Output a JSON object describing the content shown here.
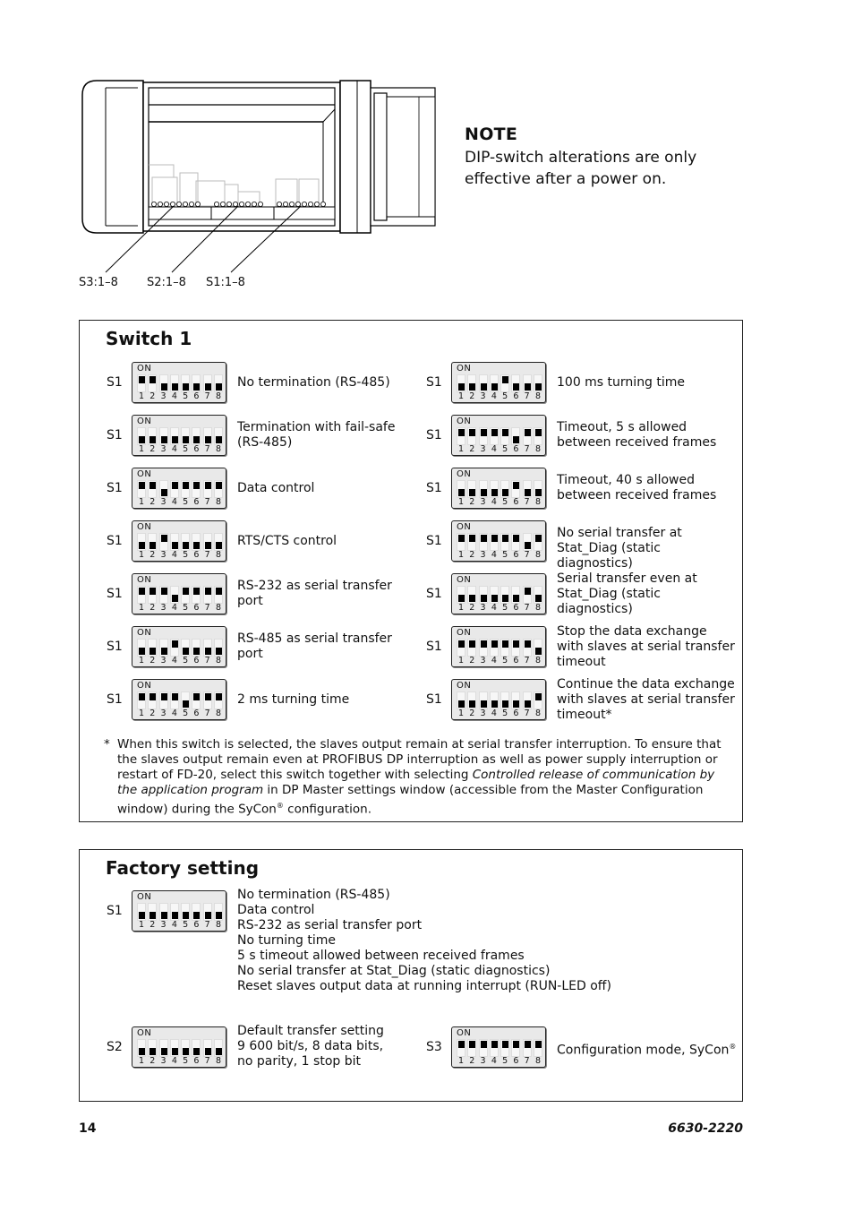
{
  "illustration": {
    "labels": [
      "S3:1–8",
      "S2:1–8",
      "S1:1–8"
    ]
  },
  "note": {
    "title": "NOTE",
    "text": "DIP-switch alterations are only effective after a power on."
  },
  "switch1": {
    "title": "Switch 1",
    "on_label": "ON",
    "left": [
      {
        "switch": "S1",
        "on": [
          1,
          2
        ],
        "desc": "No termination (RS-485)"
      },
      {
        "switch": "S1",
        "on": [],
        "desc": "Termination with fail-safe (RS-485)"
      },
      {
        "switch": "S1",
        "on": [
          1,
          2,
          4,
          5,
          6,
          7,
          8
        ],
        "desc": "Data control"
      },
      {
        "switch": "S1",
        "on": [
          3
        ],
        "desc": "RTS/CTS control"
      },
      {
        "switch": "S1",
        "on": [
          1,
          2,
          3,
          5,
          6,
          7,
          8
        ],
        "desc": "RS-232 as serial transfer port"
      },
      {
        "switch": "S1",
        "on": [
          4
        ],
        "desc": "RS-485 as serial transfer port"
      },
      {
        "switch": "S1",
        "on": [
          1,
          2,
          3,
          4,
          6,
          7,
          8
        ],
        "desc": "2 ms turning time"
      }
    ],
    "right": [
      {
        "switch": "S1",
        "on": [
          5
        ],
        "desc": "100 ms turning time"
      },
      {
        "switch": "S1",
        "on": [
          1,
          2,
          3,
          4,
          5,
          7,
          8
        ],
        "desc": "Timeout, 5 s allowed between received frames"
      },
      {
        "switch": "S1",
        "on": [
          6
        ],
        "desc": "Timeout, 40 s allowed between received frames"
      },
      {
        "switch": "S1",
        "on": [
          1,
          2,
          3,
          4,
          5,
          6,
          8
        ],
        "desc": "No serial transfer at Stat_Diag (static diagnostics)"
      },
      {
        "switch": "S1",
        "on": [
          7
        ],
        "desc": "Serial transfer even at Stat_Diag (static diagnostics)"
      },
      {
        "switch": "S1",
        "on": [
          1,
          2,
          3,
          4,
          5,
          6,
          7
        ],
        "desc": "Stop the data exchange with slaves at serial transfer timeout"
      },
      {
        "switch": "S1",
        "on": [
          8
        ],
        "desc": "Continue the data exchange with slaves at serial transfer timeout*"
      }
    ],
    "footnote": {
      "marker": "*",
      "part1": "When this switch is selected, the slaves output remain at serial transfer interruption. To ensure that the slaves output remain even at PROFIBUS DP interruption as well as power supply interruption or restart of FD-20, select this switch together with selecting ",
      "italic": "Controlled release of communication by the application program",
      "part2": " in DP Master settings window (accessible from the Master Configuration window) during the SyCon",
      "reg": "®",
      "part3": " configuration."
    }
  },
  "factory": {
    "title": "Factory setting",
    "s1": {
      "switch": "S1",
      "on": [],
      "lines": [
        "No termination (RS-485)",
        "Data control",
        "RS-232 as serial transfer port",
        "No turning time",
        "5 s timeout allowed between received frames",
        "No serial transfer at Stat_Diag (static diagnostics)",
        "Reset slaves output data at running interrupt (RUN-LED off)"
      ]
    },
    "s2": {
      "switch": "S2",
      "on": [],
      "lines": [
        "Default transfer setting",
        "9 600 bit/s, 8 data bits,",
        "no parity, 1 stop bit"
      ]
    },
    "s3": {
      "switch": "S3",
      "on": [
        1,
        2,
        3,
        4,
        5,
        6,
        7,
        8
      ],
      "desc": "Configuration mode, SyCon",
      "reg": "®"
    }
  },
  "footer": {
    "page_number": "14",
    "doc_number": "6630-2220"
  }
}
